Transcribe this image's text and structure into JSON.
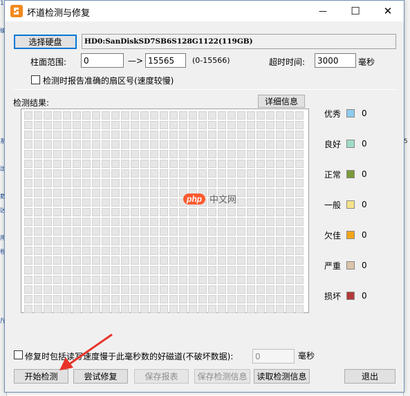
{
  "window": {
    "title": "坏道检测与修复",
    "minimize_glyph": "—",
    "maximize_glyph": "☐",
    "close_glyph": "✕"
  },
  "background_fragments": {
    "left": [
      "14",
      "",
      "硬",
      "",
      "",
      "",
      "",
      "",
      "",
      "",
      "系",
      "",
      "出",
      "",
      "数",
      "区",
      "",
      "用",
      "程",
      "",
      "",
      "",
      "",
      "斤"
    ],
    "right": [
      "",
      "",
      "",
      "",
      "",
      "",
      "",
      "",
      "",
      "",
      "5",
      "",
      "",
      "",
      "",
      "",
      "",
      "",
      "",
      "",
      "",
      "",
      "",
      ""
    ]
  },
  "disk": {
    "select_button": "选择硬盘",
    "disk_info": "HD0:SanDiskSD7SB6S128G1122(119GB)"
  },
  "range": {
    "label": "柱面范围:",
    "start_value": "0",
    "arrow": "—>",
    "end_value": "15565",
    "hint": "(0-15566)",
    "timeout_label": "超时时间:",
    "timeout_value": "3000",
    "timeout_unit": "毫秒"
  },
  "report_sector_checkbox": {
    "checked": false,
    "label": "检测时报告准确的扇区号(速度较慢)"
  },
  "results": {
    "label": "检测结果:",
    "detail_button": "详细信息",
    "grid_columns": 29,
    "grid_rows": 21
  },
  "legend": [
    {
      "name": "优秀",
      "color": "#8ecbee",
      "count": "0"
    },
    {
      "name": "良好",
      "color": "#9edcc4",
      "count": "0"
    },
    {
      "name": "正常",
      "color": "#7b9a3a",
      "count": "0"
    },
    {
      "name": "一般",
      "color": "#f5e28a",
      "count": "0"
    },
    {
      "name": "欠佳",
      "color": "#f3a51c",
      "count": "0"
    },
    {
      "name": "严重",
      "color": "#dcc3a9",
      "count": "0"
    },
    {
      "name": "损坏",
      "color": "#b23a3a",
      "count": "0"
    }
  ],
  "repair_option": {
    "checked": false,
    "label": "修复时包括读写速度慢于此毫秒数的好磁道(不破坏数据):",
    "value": "0",
    "unit": "毫秒"
  },
  "actions": {
    "start": "开始检测",
    "try_repair": "尝试修复",
    "save_report": "保存报表",
    "save_info": "保存检测信息",
    "load_info": "读取检测信息",
    "exit": "退出"
  },
  "watermark": {
    "logo": "php",
    "text": "中文网"
  },
  "colors": {
    "accent": "#0078d7",
    "annotation_arrow": "#e8342a"
  }
}
